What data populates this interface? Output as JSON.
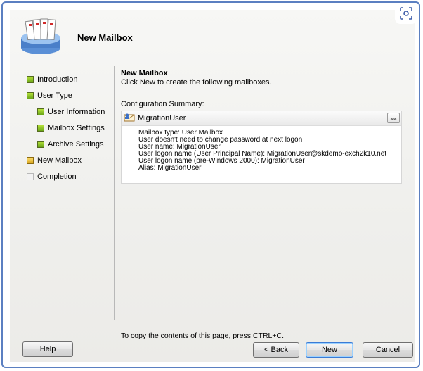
{
  "window": {
    "title": "New Mailbox"
  },
  "nav": {
    "items": [
      {
        "label": "Introduction",
        "status": "green"
      },
      {
        "label": "User Type",
        "status": "green"
      },
      {
        "label": "User Information",
        "status": "green"
      },
      {
        "label": "Mailbox Settings",
        "status": "green"
      },
      {
        "label": "Archive Settings",
        "status": "green"
      },
      {
        "label": "New Mailbox",
        "status": "yellow"
      },
      {
        "label": "Completion",
        "status": "gray"
      }
    ]
  },
  "content": {
    "heading": "New Mailbox",
    "description": "Click New to create the following mailboxes.",
    "config_label": "Configuration Summary:",
    "summary": {
      "name": "MigrationUser",
      "lines": [
        "Mailbox type: User Mailbox",
        "User doesn't need to change password at next logon",
        "User name: MigrationUser",
        "User logon name (User Principal Name): MigrationUser@skdemo-exch2k10.net",
        "User logon name (pre-Windows 2000): MigrationUser",
        "Alias: MigrationUser"
      ]
    },
    "copy_hint": "To copy the contents of this page, press CTRL+C."
  },
  "buttons": {
    "help": "Help",
    "back": "< Back",
    "new": "New",
    "cancel": "Cancel"
  },
  "colors": {
    "accent": "#3a7bd5",
    "frame": "#5b7fc1",
    "step_done": "#8cc63f",
    "step_current": "#f0c040"
  }
}
